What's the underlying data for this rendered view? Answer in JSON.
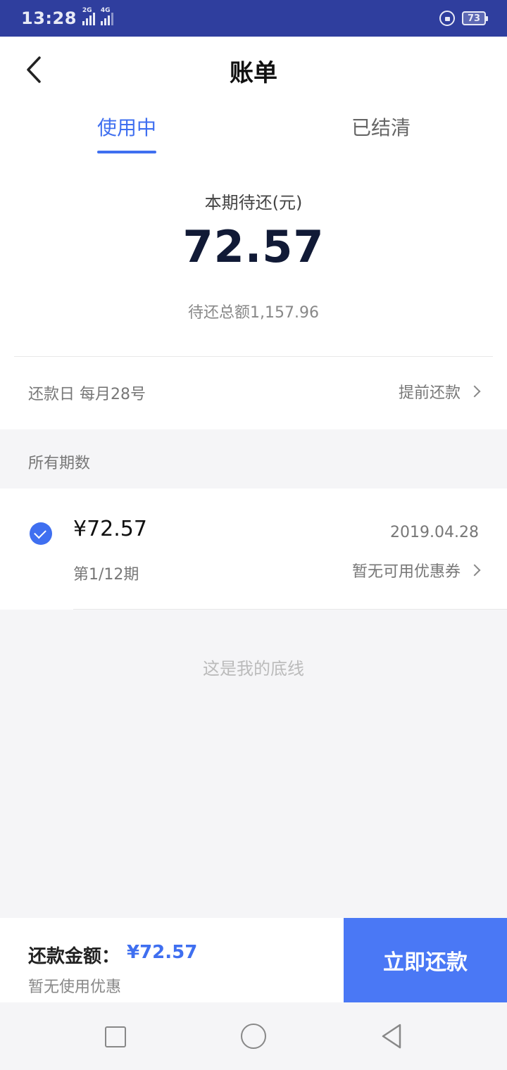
{
  "status_bar": {
    "time": "13:28",
    "sim1_type": "2G",
    "sim2_type": "4G",
    "battery": "73",
    "icons": [
      "signal-icon",
      "signal-icon",
      "rotation-lock-icon",
      "battery-icon"
    ]
  },
  "header": {
    "title": "账单",
    "back_icon": "chevron-left-icon"
  },
  "tabs": [
    {
      "label": "使用中",
      "active": true
    },
    {
      "label": "已结清",
      "active": false
    }
  ],
  "summary": {
    "due_label": "本期待还(元)",
    "due_amount": "72.57",
    "total_due": "待还总额1,157.96"
  },
  "repayment": {
    "day_text": "还款日 每月28号",
    "early_repay_label": "提前还款"
  },
  "installments": {
    "section_title": "所有期数",
    "items": [
      {
        "amount": "¥72.57",
        "period": "第1/12期",
        "date": "2019.04.28",
        "coupon": "暂无可用优惠券",
        "checked": true
      }
    ]
  },
  "footer_note": "这是我的底线",
  "pay_bar": {
    "label": "还款金额：",
    "amount": "¥72.57",
    "sub": "暂无使用优惠",
    "button_label": "立即还款"
  },
  "colors": {
    "status_bar": "#2f3e9e",
    "accent": "#3f6ff0",
    "button": "#4a78f5",
    "background": "#f5f5f7"
  }
}
